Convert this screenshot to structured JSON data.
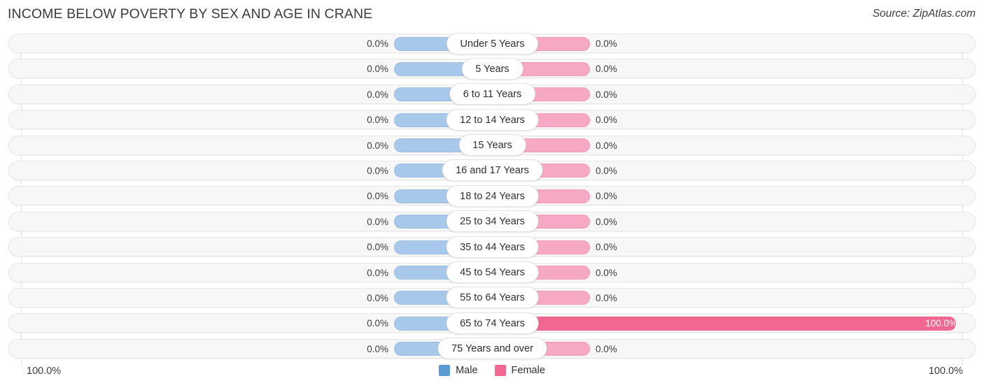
{
  "header": {
    "title": "INCOME BELOW POVERTY BY SEX AND AGE IN CRANE",
    "source": "Source: ZipAtlas.com"
  },
  "legend": {
    "male_label": "Male",
    "female_label": "Female",
    "male_color": "#5b9bd5",
    "female_color": "#f2678f"
  },
  "axis": {
    "left_max": "100.0%",
    "right_max": "100.0%"
  },
  "colors": {
    "male_bar": "#a8c8ea",
    "female_bar": "#f6a8c4",
    "female_bar_full": "#f2678f",
    "track": "#f7f7f7",
    "text": "#3c3c42"
  },
  "chart_data": {
    "type": "bar",
    "title": "INCOME BELOW POVERTY BY SEX AND AGE IN CRANE",
    "xlabel": "",
    "ylabel": "",
    "orientation": "horizontal-diverging",
    "xlim": [
      0,
      100
    ],
    "grid": true,
    "legend_position": "bottom-center",
    "categories": [
      "Under 5 Years",
      "5 Years",
      "6 to 11 Years",
      "12 to 14 Years",
      "15 Years",
      "16 and 17 Years",
      "18 to 24 Years",
      "25 to 34 Years",
      "35 to 44 Years",
      "45 to 54 Years",
      "55 to 64 Years",
      "65 to 74 Years",
      "75 Years and over"
    ],
    "series": [
      {
        "name": "Male",
        "values": [
          0.0,
          0.0,
          0.0,
          0.0,
          0.0,
          0.0,
          0.0,
          0.0,
          0.0,
          0.0,
          0.0,
          0.0,
          0.0
        ]
      },
      {
        "name": "Female",
        "values": [
          0.0,
          0.0,
          0.0,
          0.0,
          0.0,
          0.0,
          0.0,
          0.0,
          0.0,
          0.0,
          0.0,
          100.0,
          0.0
        ]
      }
    ]
  },
  "rows": [
    {
      "label": "Under 5 Years",
      "male_value": "0.0%",
      "female_value": "0.0%",
      "male_pct": 0,
      "female_pct": 0
    },
    {
      "label": "5 Years",
      "male_value": "0.0%",
      "female_value": "0.0%",
      "male_pct": 0,
      "female_pct": 0
    },
    {
      "label": "6 to 11 Years",
      "male_value": "0.0%",
      "female_value": "0.0%",
      "male_pct": 0,
      "female_pct": 0
    },
    {
      "label": "12 to 14 Years",
      "male_value": "0.0%",
      "female_value": "0.0%",
      "male_pct": 0,
      "female_pct": 0
    },
    {
      "label": "15 Years",
      "male_value": "0.0%",
      "female_value": "0.0%",
      "male_pct": 0,
      "female_pct": 0
    },
    {
      "label": "16 and 17 Years",
      "male_value": "0.0%",
      "female_value": "0.0%",
      "male_pct": 0,
      "female_pct": 0
    },
    {
      "label": "18 to 24 Years",
      "male_value": "0.0%",
      "female_value": "0.0%",
      "male_pct": 0,
      "female_pct": 0
    },
    {
      "label": "25 to 34 Years",
      "male_value": "0.0%",
      "female_value": "0.0%",
      "male_pct": 0,
      "female_pct": 0
    },
    {
      "label": "35 to 44 Years",
      "male_value": "0.0%",
      "female_value": "0.0%",
      "male_pct": 0,
      "female_pct": 0
    },
    {
      "label": "45 to 54 Years",
      "male_value": "0.0%",
      "female_value": "0.0%",
      "male_pct": 0,
      "female_pct": 0
    },
    {
      "label": "55 to 64 Years",
      "male_value": "0.0%",
      "female_value": "0.0%",
      "male_pct": 0,
      "female_pct": 0
    },
    {
      "label": "65 to 74 Years",
      "male_value": "0.0%",
      "female_value": "100.0%",
      "male_pct": 0,
      "female_pct": 100
    },
    {
      "label": "75 Years and over",
      "male_value": "0.0%",
      "female_value": "0.0%",
      "male_pct": 0,
      "female_pct": 0
    }
  ]
}
